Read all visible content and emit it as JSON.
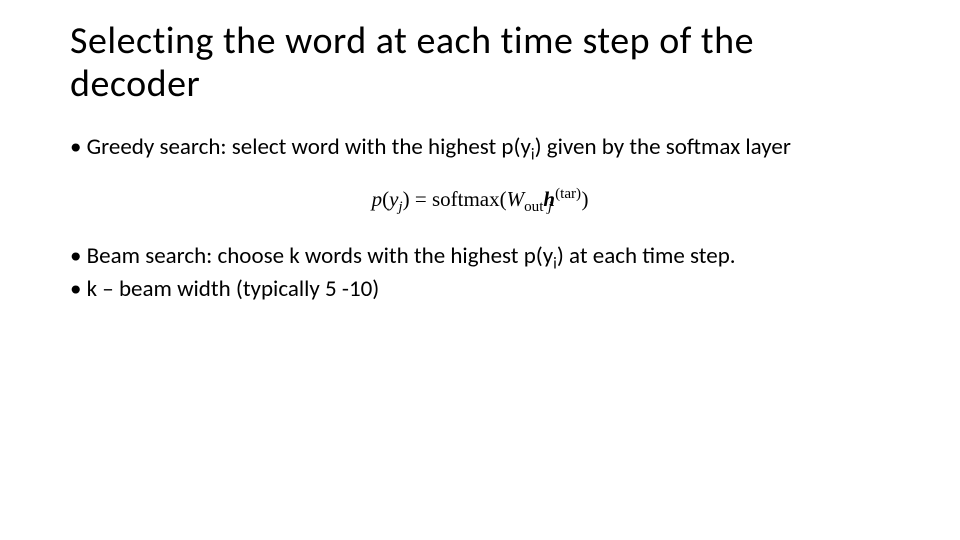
{
  "title": "Selecting the word at each time step of the decoder",
  "bullets": {
    "greedy_pre": "Greedy search: select word with the highest p(y",
    "greedy_sub": "i",
    "greedy_post": ") given by the softmax layer",
    "beam_pre": "Beam search: choose k words with the highest p(y",
    "beam_sub": "i",
    "beam_post": ") at each time step.",
    "kline": "k – beam width (typically 5 -10)"
  },
  "formula": {
    "p": "p",
    "lp": "(",
    "y": "y",
    "j1": "j",
    "rp": ")",
    "eq": " = ",
    "softmax": "softmax",
    "lp2": "(",
    "W": "W",
    "out": "out",
    "h": "h",
    "j2": "j",
    "tar": "(tar)",
    "rp2": ")"
  }
}
